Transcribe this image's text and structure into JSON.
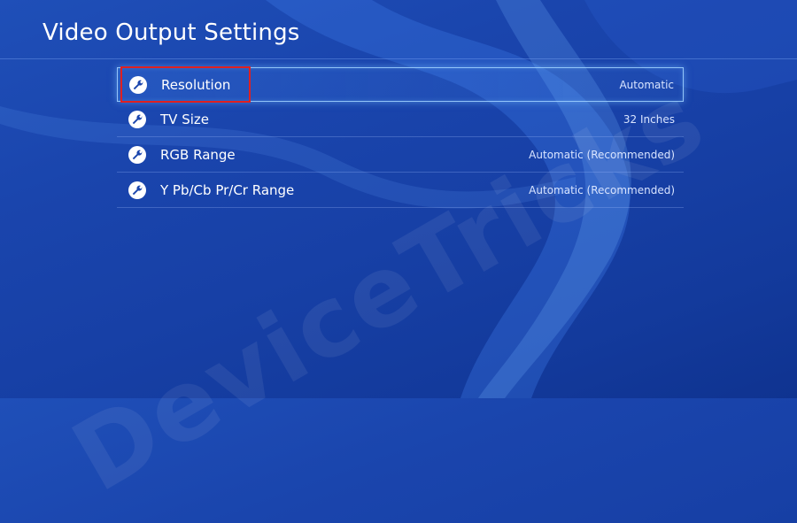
{
  "screen": {
    "title": "Video Output Settings",
    "watermark": "DeviceTricks"
  },
  "settings": [
    {
      "label": "Resolution",
      "value": "Automatic",
      "icon": "wrench-icon",
      "focused": true
    },
    {
      "label": "TV Size",
      "value": "32 Inches",
      "icon": "wrench-icon"
    },
    {
      "label": "RGB Range",
      "value": "Automatic (Recommended)",
      "icon": "wrench-icon"
    },
    {
      "label": "Y Pb/Cb Pr/Cr Range",
      "value": "Automatic (Recommended)",
      "icon": "wrench-icon"
    }
  ],
  "colors": {
    "background": "#1a45ad",
    "highlight_annotation": "#e02020",
    "focus_glow": "#a0d2ff"
  }
}
